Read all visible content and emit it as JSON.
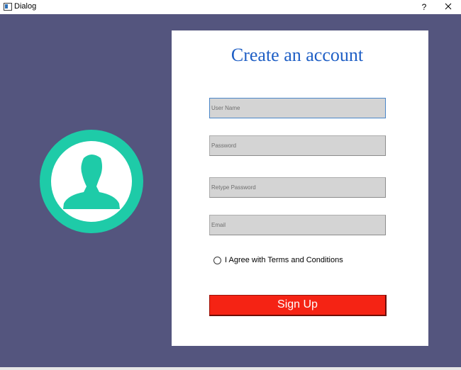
{
  "window": {
    "title": "Dialog",
    "help_label": "?",
    "close_label": "close"
  },
  "colors": {
    "background": "#54557e",
    "card": "#ffffff",
    "title": "#1f5fc5",
    "field_fill": "#d4d4d4",
    "accent_teal": "#1ecba8",
    "signup_button": "#f52314"
  },
  "form": {
    "title": "Create an account",
    "username_placeholder": "User Name",
    "password_placeholder": "Password",
    "retype_placeholder": "Retype Password",
    "email_placeholder": "Email",
    "terms_label": "I Agree with Terms and Conditions",
    "signup_label": "Sign Up"
  },
  "avatar_icon": "user-avatar-icon"
}
